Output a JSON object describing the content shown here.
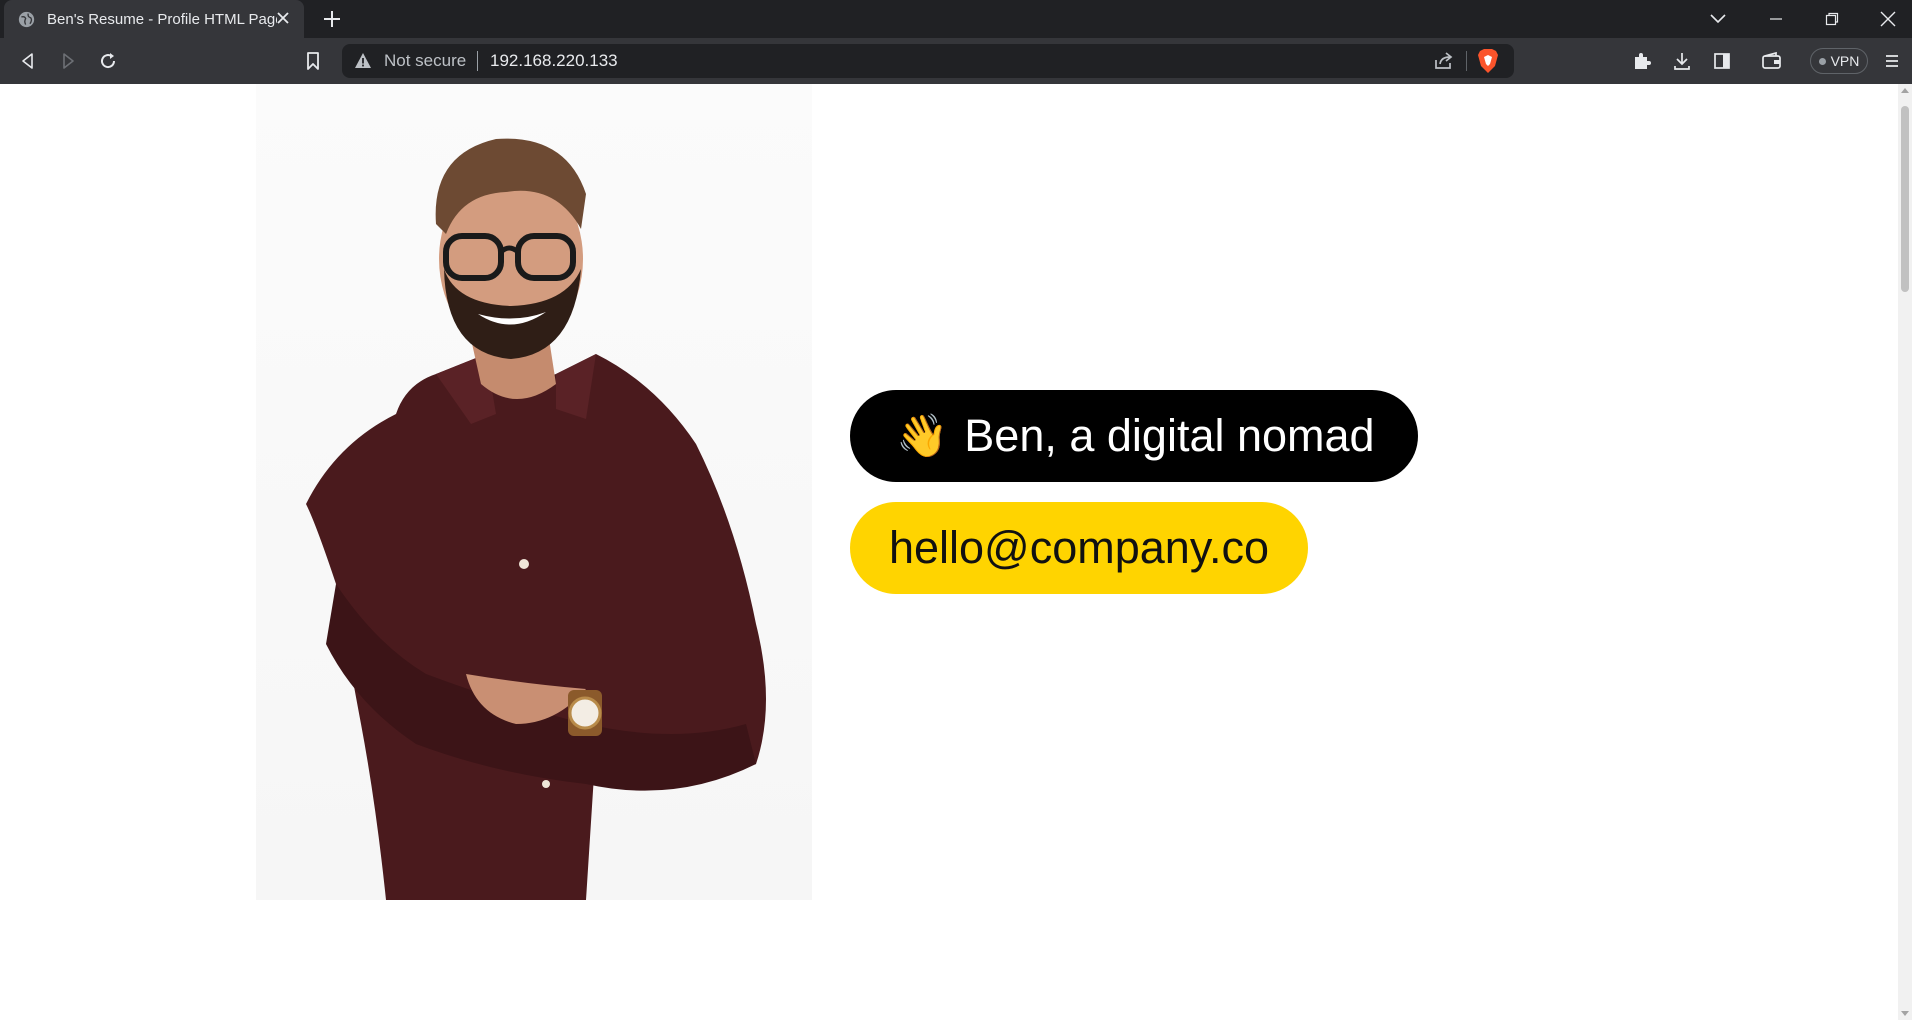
{
  "browser": {
    "tab": {
      "title": "Ben's Resume - Profile HTML Page"
    },
    "address_bar": {
      "security_label": "Not secure",
      "url": "192.168.220.133"
    },
    "vpn_label": "VPN"
  },
  "page": {
    "greeting_icon": "👋",
    "name_text": "Ben, a digital nomad",
    "email": "hello@company.co",
    "photo_alt": "Ben portrait",
    "colors": {
      "name_pill": "#000000",
      "email_pill": "#FFD400",
      "shirt": "#4a1a1d"
    }
  }
}
